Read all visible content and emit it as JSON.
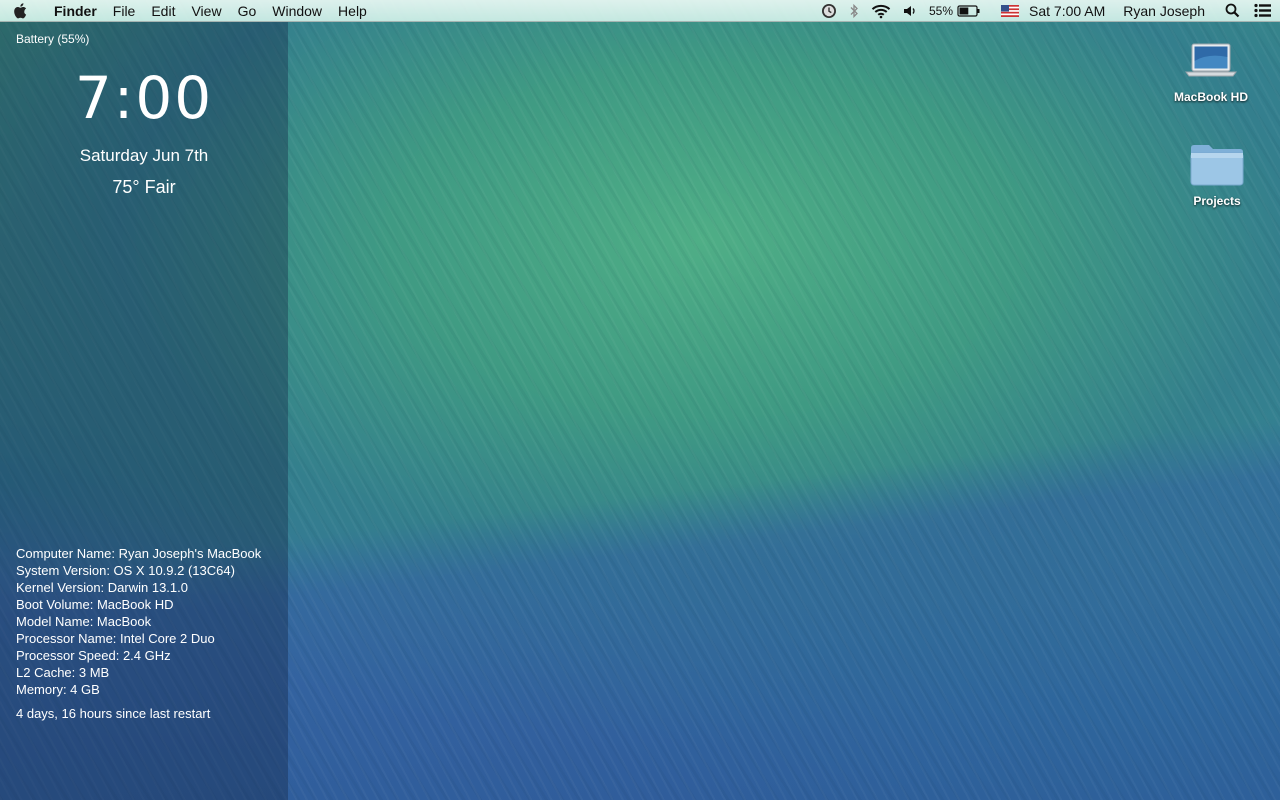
{
  "menubar": {
    "app_name": "Finder",
    "menus": [
      "File",
      "Edit",
      "View",
      "Go",
      "Window",
      "Help"
    ],
    "battery_percent": "55%",
    "battery_level": 0.55,
    "clock": "Sat 7:00 AM",
    "user": "Ryan Joseph",
    "icons": [
      "apple-icon",
      "time-machine-icon",
      "bluetooth-icon",
      "wifi-icon",
      "volume-icon",
      "battery-icon",
      "us-flag-input-icon",
      "spotlight-icon",
      "notification-center-icon"
    ]
  },
  "widget": {
    "battery": "Battery (55%)",
    "time": "7:00",
    "date": "Saturday Jun 7th",
    "weather": "75° Fair",
    "sysinfo": [
      "Computer Name: Ryan Joseph's MacBook",
      "System Version: OS X 10.9.2 (13C64)",
      "Kernel Version: Darwin 13.1.0",
      "Boot Volume: MacBook HD",
      "Model Name: MacBook",
      "Processor Name: Intel Core 2 Duo",
      "Processor Speed: 2.4 GHz",
      "L2 Cache: 3 MB",
      "Memory: 4 GB"
    ],
    "uptime": "4 days, 16 hours since last restart"
  },
  "desktop": {
    "icons": [
      {
        "label": "MacBook HD",
        "icon": "laptop-drive-icon"
      },
      {
        "label": "Projects",
        "icon": "folder-icon"
      }
    ]
  },
  "colors": {
    "menubar_bg": "#dff5ee",
    "widget_bg": "rgba(20,40,70,0.38)",
    "folder_blue": "#9cc6e6"
  }
}
